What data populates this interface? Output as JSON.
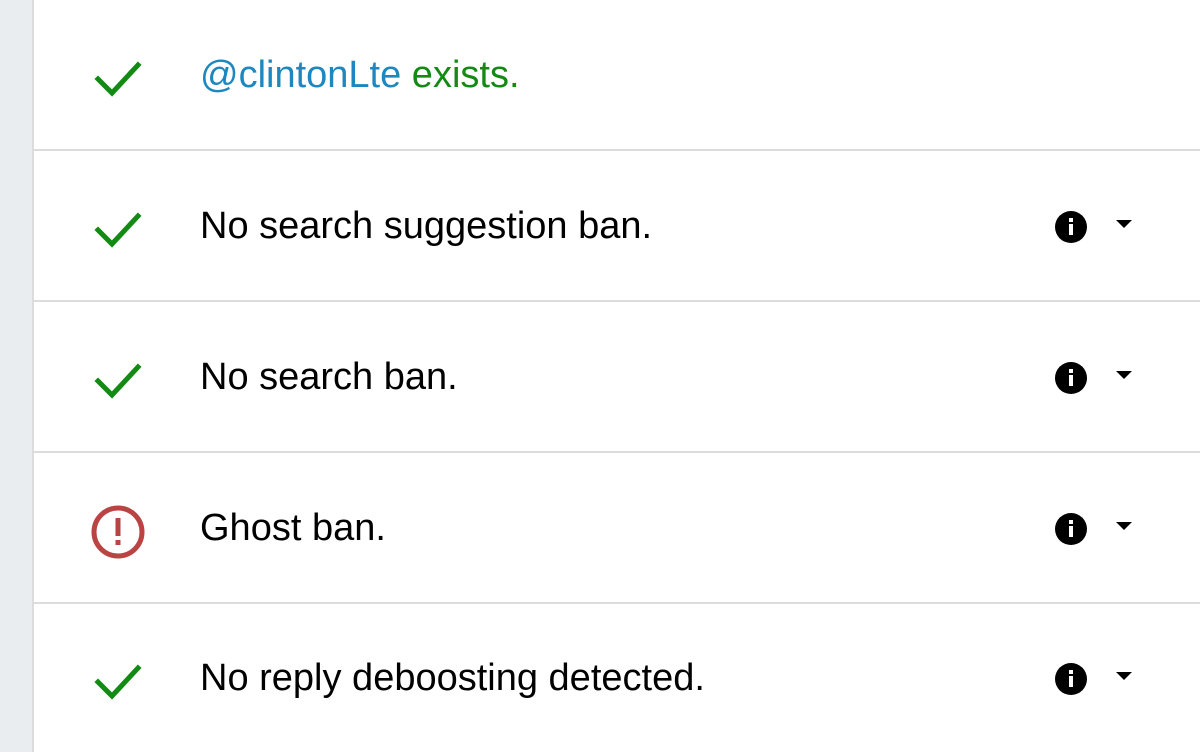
{
  "colors": {
    "ok": "#138a13",
    "error": "#b94443",
    "handle": "#1d87c0",
    "divider": "#dcdcdc",
    "background": "#e9edf0"
  },
  "rows": [
    {
      "status": "ok",
      "status_icon": "check-icon",
      "handle": "@clintonLte",
      "text": " exists.",
      "has_info": false
    },
    {
      "status": "ok",
      "status_icon": "check-icon",
      "text": "No search suggestion ban.",
      "has_info": true,
      "info_icon": "info-icon",
      "toggle_icon": "caret-down-icon"
    },
    {
      "status": "ok",
      "status_icon": "check-icon",
      "text": "No search ban.",
      "has_info": true,
      "info_icon": "info-icon",
      "toggle_icon": "caret-down-icon"
    },
    {
      "status": "error",
      "status_icon": "alert-circle-icon",
      "text": "Ghost ban.",
      "has_info": true,
      "info_icon": "info-icon",
      "toggle_icon": "caret-down-icon"
    },
    {
      "status": "ok",
      "status_icon": "check-icon",
      "text": "No reply deboosting detected.",
      "has_info": true,
      "info_icon": "info-icon",
      "toggle_icon": "caret-down-icon"
    }
  ]
}
